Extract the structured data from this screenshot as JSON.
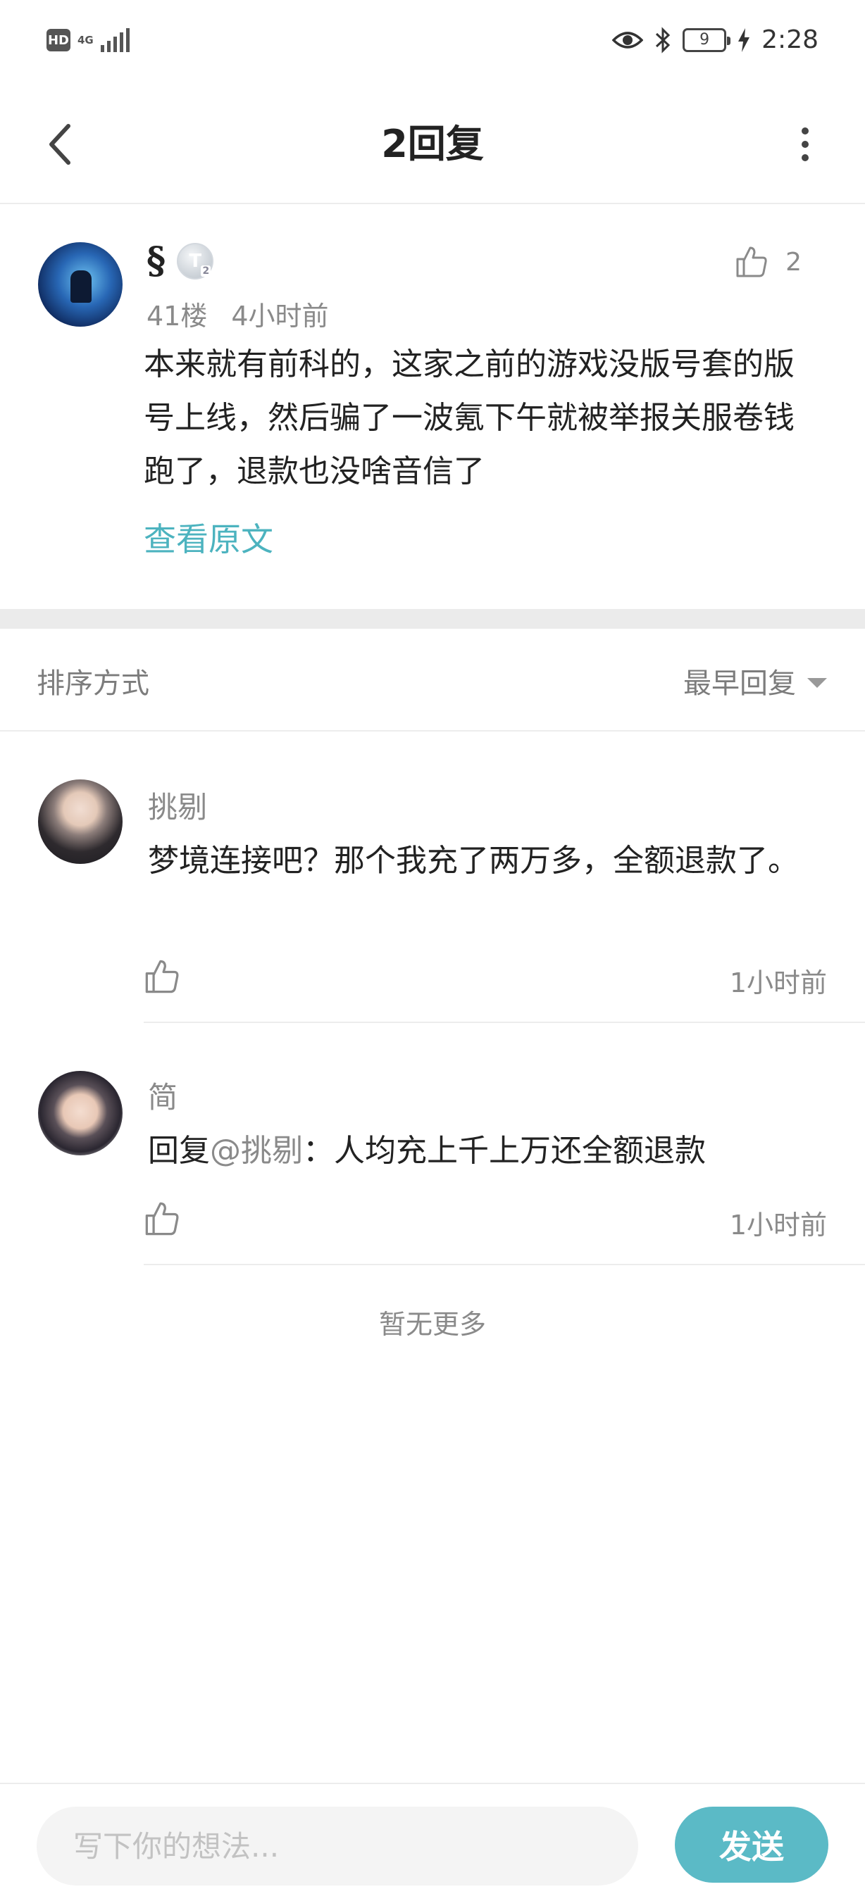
{
  "status_bar": {
    "hd": "HD",
    "network": "4G",
    "battery": "9",
    "time": "2:28"
  },
  "header": {
    "title": "2回复"
  },
  "post": {
    "username": "§",
    "level_badge": "T",
    "level_num": "2",
    "like_count": "2",
    "floor": "41楼",
    "time": "4小时前",
    "content": "本来就有前科的，这家之前的游戏没版号套的版号上线，然后骗了一波氪下午就被举报关服卷钱跑了，退款也没啥音信了",
    "view_original": "查看原文"
  },
  "sort": {
    "label": "排序方式",
    "selected": "最早回复"
  },
  "replies": [
    {
      "username": "挑剔",
      "content": "梦境连接吧？那个我充了两万多，全额退款了。",
      "time": "1小时前"
    },
    {
      "username": "简",
      "prefix": "回复",
      "mention": "@挑剔",
      "content": "：人均充上千上万还全额退款",
      "time": "1小时前"
    }
  ],
  "footer_note": "暂无更多",
  "composer": {
    "placeholder": "写下你的想法...",
    "send_label": "发送"
  },
  "colors": {
    "accent": "#4cb3bf",
    "send_button": "#5bbac6"
  }
}
